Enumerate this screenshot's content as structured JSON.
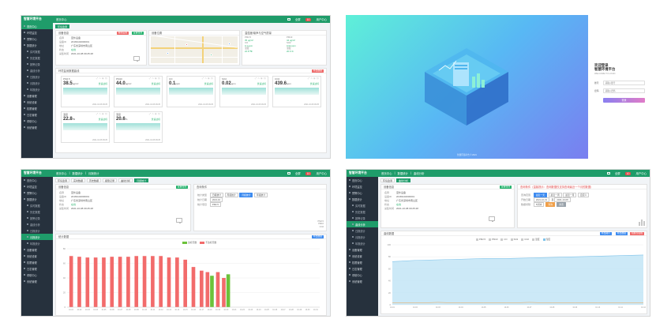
{
  "app": {
    "brand": "智慧环境平台",
    "user": "用户中心",
    "fullscreen": "全屏",
    "alarm_label": "告警信息",
    "alarm_count": "10"
  },
  "sidebar": [
    {
      "label": "首页中心",
      "sub": false
    },
    {
      "label": "环境监控",
      "sub": false
    },
    {
      "label": "预警中心",
      "sub": false
    },
    {
      "label": "数据统计",
      "sub": false
    },
    {
      "label": "实时数据",
      "sub": true
    },
    {
      "label": "历史数据",
      "sub": true
    },
    {
      "label": "报警记录",
      "sub": true
    },
    {
      "label": "曲线分析",
      "sub": true
    },
    {
      "label": "日报统计",
      "sub": true
    },
    {
      "label": "月报统计",
      "sub": true
    },
    {
      "label": "年报统计",
      "sub": true
    },
    {
      "label": "设备管理",
      "sub": false
    },
    {
      "label": "系统设置",
      "sub": false
    },
    {
      "label": "权限管理",
      "sub": false
    },
    {
      "label": "日志管理",
      "sub": false
    },
    {
      "label": "帮助中心",
      "sub": false
    },
    {
      "label": "系统管理",
      "sub": false
    }
  ],
  "q1": {
    "crumbs": [
      "首页中心"
    ],
    "tab": "环境监测",
    "device_title": "设备信息",
    "btn_edit": "编辑设备",
    "btn_online": "设备在线",
    "map_title": "设备位置",
    "env_title": "温湿度/噪声与空气质量",
    "info": [
      {
        "k": "名称",
        "v": "室外设备"
      },
      {
        "k": "设备ID",
        "v": "20181102000001"
      },
      {
        "k": "地址",
        "v": "广东省深圳市南山区"
      },
      {
        "k": "状态",
        "v": "在线"
      },
      {
        "k": "采集时间",
        "v": "2021-10-08 09:25:48"
      }
    ],
    "env": [
      {
        "k": "PM2.5",
        "v": "35 μg/m³"
      },
      {
        "k": "PM10",
        "v": "44 μg/m³"
      },
      {
        "k": "CO",
        "v": "0.1 ppm"
      },
      {
        "k": "SO2",
        "v": "0.02 ppm"
      },
      {
        "k": "温度",
        "v": "22.8 ℃"
      },
      {
        "k": "湿度",
        "v": "20.6 %"
      }
    ],
    "metrics_title": "环境监测数据曲线",
    "btn_export": "导出数据",
    "metrics": [
      {
        "name": "PM2.5",
        "value": "38.5",
        "unit": "μg/m³",
        "status": "优良达标",
        "time": "2021-10-08 09:25"
      },
      {
        "name": "PM10",
        "value": "44.0",
        "unit": "μg/m³",
        "status": "优良达标",
        "time": "2021-10-08 09:25"
      },
      {
        "name": "CO",
        "value": "0.1",
        "unit": "ppm",
        "status": "优良达标",
        "time": "2021-10-08 09:25"
      },
      {
        "name": "SO2",
        "value": "0.02",
        "unit": "ppm",
        "status": "优良达标",
        "time": "2021-10-08 09:25"
      },
      {
        "name": "CO2",
        "value": "439.6",
        "unit": "ppm",
        "status": "优良达标",
        "time": "2021-10-08 09:25"
      },
      {
        "name": "温度",
        "value": "22.8",
        "unit": "℃",
        "status": "优良达标",
        "time": "2021-10-08 09:25"
      },
      {
        "name": "湿度",
        "value": "20.6",
        "unit": "%",
        "status": "优良达标",
        "time": "2021-10-08 09:25"
      }
    ]
  },
  "login": {
    "title_line1": "欢迎登录",
    "title_line2": "智慧环境平台",
    "subtitle": "WELCOME TO LOGIN",
    "user_label": "账号",
    "user_placeholder": "请输入账号",
    "pass_label": "密码",
    "pass_placeholder": "请输入密码",
    "submit": "登录",
    "footer": "智慧环境平台 © 2021"
  },
  "q3": {
    "crumbs": [
      "首页中心",
      "数据统计",
      "月报统计"
    ],
    "tabs": [
      "环境监测",
      "实时数据",
      "历史数据",
      "报警记录",
      "曲线分析",
      "月报统计"
    ],
    "device_title": "设备信息",
    "btn_online": "设备在线",
    "query_title": "查询条件",
    "query_type_label": "统计类型",
    "query_types": [
      "日报统计",
      "周报统计",
      "月报统计",
      "年报统计"
    ],
    "query_type_selected": 2,
    "date_label": "统计日期",
    "date_value": "2021-10",
    "item_label": "统计项目",
    "item_value": "PM2.5",
    "mini_legend": [
      "PM2.5",
      "PM10",
      "CO2"
    ],
    "chart_title": "统计数据",
    "btn_export": "导出数据",
    "legend": [
      "达标天数",
      "不达标天数"
    ],
    "colors": {
      "red": "#f26b6b",
      "green": "#6cc23a"
    }
  },
  "q4": {
    "crumbs": [
      "首页中心",
      "数据统计",
      "曲线分析"
    ],
    "tabs": [
      "环境监测",
      "曲线分析"
    ],
    "device_title": "设备信息",
    "btn_online": "设备在线",
    "query_title": "查询条件（温馨提示：查询数据仅支持查询最近一个月的数据）",
    "range_label": "查询范围",
    "ranges": [
      "最近一天",
      "最近一周",
      "最近一月",
      "自定义"
    ],
    "range_selected": 0,
    "date_label": "开始日期",
    "start_date": "2021-10-01",
    "end_label": "至",
    "end_date": "2021-10-08",
    "interval_label": "数据间隔",
    "interval_value": "5分钟",
    "btn_query": "查询",
    "btn_reset": "重置",
    "chart_title": "曲线数据",
    "btns": [
      "导出图片",
      "导出数据",
      "切换为表格"
    ],
    "series_toggles": [
      "PM2.5",
      "PM10",
      "CO",
      "SO2",
      "CO2",
      "温度",
      "湿度"
    ],
    "colors": {
      "area": "#bfe3f5",
      "line": "#7fc3ea"
    }
  },
  "chart_data": [
    {
      "type": "bar",
      "categories": [
        "10-01",
        "10-02",
        "10-03",
        "10-04",
        "10-05",
        "10-06",
        "10-07",
        "10-08",
        "10-09",
        "10-10",
        "10-11",
        "10-12",
        "10-13",
        "10-14",
        "10-15",
        "10-16",
        "10-17",
        "10-18",
        "10-19",
        "10-20",
        "10-21",
        "10-22",
        "10-23",
        "10-24",
        "10-25",
        "10-26",
        "10-27",
        "10-28",
        "10-29",
        "10-30",
        "10-31"
      ],
      "series": [
        {
          "name": "不达标天数",
          "values": [
            70,
            69,
            68,
            68,
            68,
            69,
            69,
            69,
            70,
            70,
            70,
            70,
            68,
            68,
            65,
            55,
            50,
            48,
            48,
            40,
            0,
            0,
            0,
            0,
            0,
            0,
            0,
            0,
            0,
            0,
            0
          ]
        },
        {
          "name": "达标天数",
          "values": [
            0,
            0,
            0,
            0,
            0,
            0,
            0,
            0,
            0,
            0,
            0,
            0,
            0,
            0,
            0,
            0,
            0,
            43,
            0,
            45,
            0,
            0,
            0,
            0,
            0,
            0,
            0,
            0,
            0,
            0,
            0
          ]
        }
      ],
      "ylim": [
        0,
        80
      ],
      "yticks": [
        0,
        20,
        40,
        60,
        80
      ]
    },
    {
      "type": "area",
      "x_labels": [
        "10-01",
        "10-02",
        "10-03",
        "10-04",
        "10-05",
        "10-06",
        "10-07",
        "10-08",
        "10-09",
        "10-10",
        "10-11",
        "10-12"
      ],
      "series": [
        {
          "name": "湿度",
          "values": [
            72,
            74,
            75,
            76,
            77,
            77,
            78,
            79,
            80,
            81,
            82,
            83
          ]
        },
        {
          "name": "PM2.5",
          "values": [
            3,
            3,
            4,
            3,
            3,
            3,
            4,
            3,
            3,
            3,
            3,
            3
          ]
        }
      ],
      "ylim": [
        0,
        100
      ],
      "yticks": [
        0,
        20,
        40,
        60,
        80,
        100
      ]
    }
  ]
}
